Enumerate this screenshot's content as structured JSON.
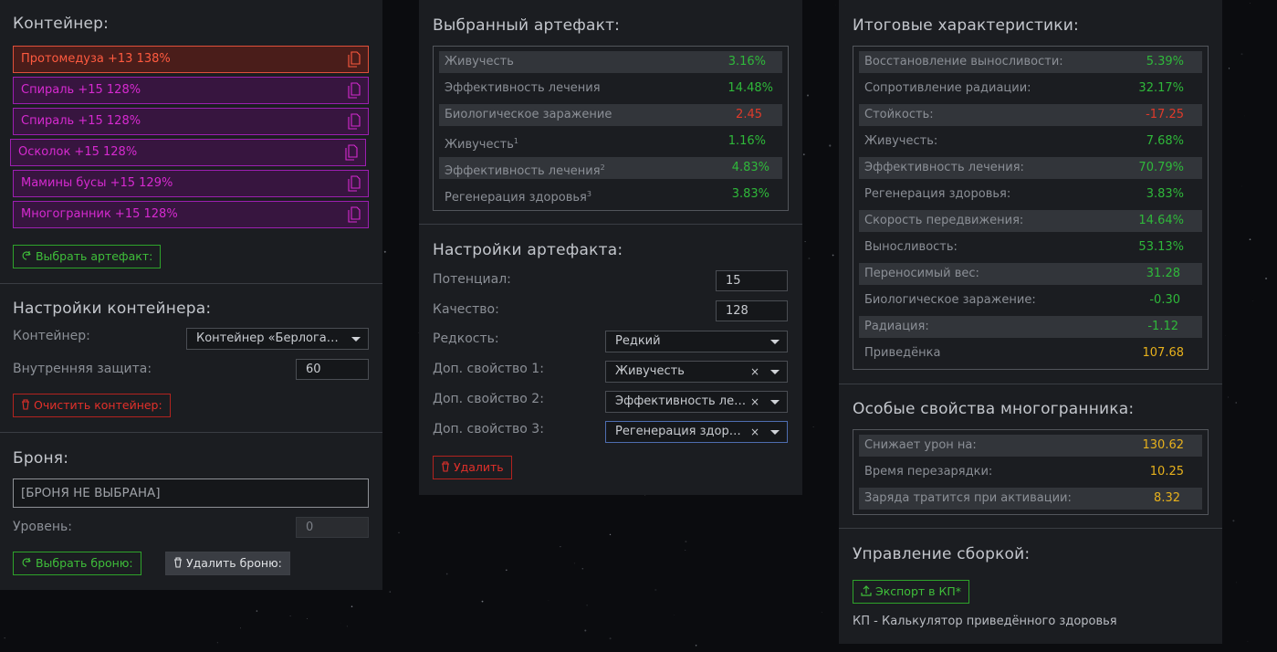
{
  "container": {
    "title": "Контейнер:",
    "items": [
      {
        "label": "Протомедуза +13 138%",
        "kind": "hot"
      },
      {
        "label": "Спираль +15 128%",
        "kind": "normal"
      },
      {
        "label": "Спираль +15 128%",
        "kind": "normal"
      },
      {
        "label": "Осколок +15 128%",
        "kind": "normal"
      },
      {
        "label": "Мамины бусы +15 129%",
        "kind": "normal"
      },
      {
        "label": "Многогранник +15 128%",
        "kind": "normal"
      }
    ],
    "select_button": "Выбрать артефакт:"
  },
  "container_settings": {
    "title": "Настройки контейнера:",
    "container_label": "Контейнер:",
    "container_value": "Контейнер «Берлога…",
    "protection_label": "Внутренняя защита:",
    "protection_value": "60",
    "clear_button": "Очистить контейнер:"
  },
  "armor": {
    "title": "Броня:",
    "armor_value": "[БРОНЯ НЕ ВЫБРАНА]",
    "level_label": "Уровень:",
    "level_value": "0",
    "select_button": "Выбрать броню:",
    "delete_button": "Удалить броню:"
  },
  "selected_artifact": {
    "title": "Выбранный артефакт:",
    "rows": [
      {
        "name": "Живучесть",
        "sup": "",
        "value": "3.16%",
        "tone": "g"
      },
      {
        "name": "Эффективность лечения",
        "sup": "",
        "value": "14.48%",
        "tone": "g"
      },
      {
        "name": "Биологическое заражение",
        "sup": "",
        "value": "2.45",
        "tone": "r"
      },
      {
        "name": "Живучесть",
        "sup": "1",
        "value": "1.16%",
        "tone": "g"
      },
      {
        "name": "Эффективность лечения",
        "sup": "2",
        "value": "4.83%",
        "tone": "g"
      },
      {
        "name": "Регенерация здоровья",
        "sup": "3",
        "value": "3.83%",
        "tone": "g"
      }
    ]
  },
  "artifact_settings": {
    "title": "Настройки артефакта:",
    "potential_label": "Потенциал:",
    "potential_value": "15",
    "quality_label": "Качество:",
    "quality_value": "128",
    "rarity_label": "Редкость:",
    "rarity_value": "Редкий",
    "prop1_label": "Доп. свойство 1:",
    "prop1_value": "Живучесть",
    "prop2_label": "Доп. свойство 2:",
    "prop2_value": "Эффективность ле…",
    "prop3_label": "Доп. свойство 3:",
    "prop3_value": "Регенерация здор…",
    "clear_glyph": "×",
    "delete_button": "Удалить"
  },
  "totals": {
    "title": "Итоговые характеристики:",
    "rows": [
      {
        "name": "Восстановление выносливости:",
        "value": "5.39%",
        "tone": "g"
      },
      {
        "name": "Сопротивление радиации:",
        "value": "32.17%",
        "tone": "g"
      },
      {
        "name": "Стойкость:",
        "value": "-17.25",
        "tone": "r"
      },
      {
        "name": "Живучесть:",
        "value": "7.68%",
        "tone": "g"
      },
      {
        "name": "Эффективность лечения:",
        "value": "70.79%",
        "tone": "g"
      },
      {
        "name": "Регенерация здоровья:",
        "value": "3.83%",
        "tone": "g"
      },
      {
        "name": "Скорость передвижения:",
        "value": "14.64%",
        "tone": "g"
      },
      {
        "name": "Выносливость:",
        "value": "53.13%",
        "tone": "g"
      },
      {
        "name": "Переносимый вес:",
        "value": "31.28",
        "tone": "g"
      },
      {
        "name": "Биологическое заражение:",
        "value": "-0.30",
        "tone": "g"
      },
      {
        "name": "Радиация:",
        "value": "-1.12",
        "tone": "g"
      },
      {
        "name": "Приведёнка",
        "value": "107.68",
        "tone": "y"
      }
    ]
  },
  "special": {
    "title": "Особые свойства многогранника:",
    "rows": [
      {
        "name": "Снижает урон на:",
        "value": "130.62",
        "tone": "y"
      },
      {
        "name": "Время перезарядки:",
        "value": "10.25",
        "tone": "y"
      },
      {
        "name": "Заряда тратится при активации:",
        "value": "8.32",
        "tone": "y"
      }
    ]
  },
  "build": {
    "title": "Управление сборкой:",
    "export_button": "Экспорт в КП*",
    "footnote": "КП - Калькулятор приведённого здоровья"
  },
  "colors": {
    "green": "#3fbf3a",
    "red": "#e3302a",
    "yellow": "#e7b11c",
    "purple": "#d62ad0",
    "orange": "#ff5a3f"
  }
}
